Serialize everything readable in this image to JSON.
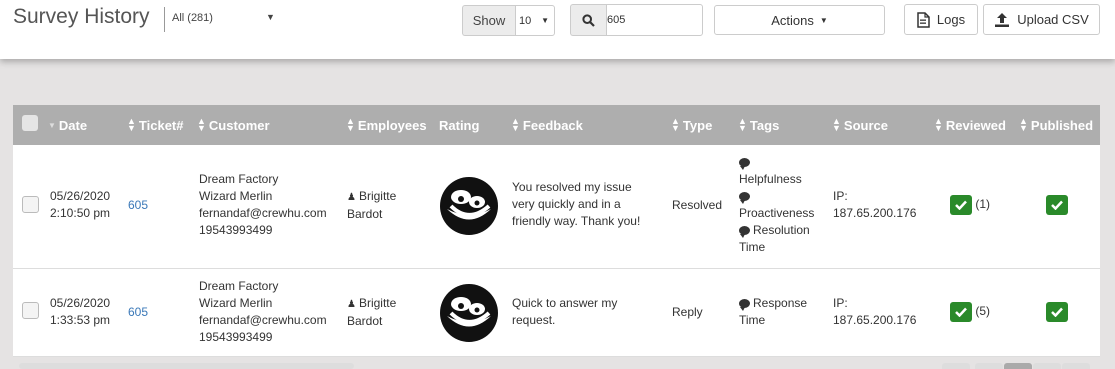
{
  "header": {
    "title": "Survey History",
    "filter_value": "All (281)",
    "show_label": "Show",
    "show_value": "10",
    "search_value": "605",
    "actions_label": "Actions",
    "logs_label": "Logs",
    "upload_label": "Upload CSV"
  },
  "table": {
    "columns": [
      "Date",
      "Ticket#",
      "Customer",
      "Employees",
      "Rating",
      "Feedback",
      "Type",
      "Tags",
      "Source",
      "Reviewed",
      "Published"
    ],
    "rows": [
      {
        "date": "05/26/2020",
        "time": "2:10:50 pm",
        "ticket": "605",
        "customer_company": "Dream Factory",
        "customer_name": "Wizard Merlin",
        "customer_email": "fernandaf@crewhu.com",
        "customer_phone": "19543993499",
        "employee_first": "Brigitte",
        "employee_last": "Bardot",
        "rating_icon": "happy-face-icon",
        "feedback": "You resolved my issue very quickly and in a friendly way. Thank you!",
        "type": "Resolved",
        "tags": [
          "Helpfulness",
          "Proactiveness",
          "Resolution Time"
        ],
        "source_label": "IP:",
        "source_ip": "187.65.200.176",
        "reviewed_count": "(1)"
      },
      {
        "date": "05/26/2020",
        "time": "1:33:53 pm",
        "ticket": "605",
        "customer_company": "Dream Factory",
        "customer_name": "Wizard Merlin",
        "customer_email": "fernandaf@crewhu.com",
        "customer_phone": "19543993499",
        "employee_first": "Brigitte",
        "employee_last": "Bardot",
        "rating_icon": "happy-face-icon",
        "feedback": "Quick to answer my request.",
        "type": "Reply",
        "tags": [
          "Response Time"
        ],
        "source_label": "IP:",
        "source_ip": "187.65.200.176",
        "reviewed_count": "(5)"
      }
    ]
  },
  "colors": {
    "header_bg": "#aeaeae",
    "link": "#3a78b8",
    "check_green": "#2a8a2a"
  }
}
